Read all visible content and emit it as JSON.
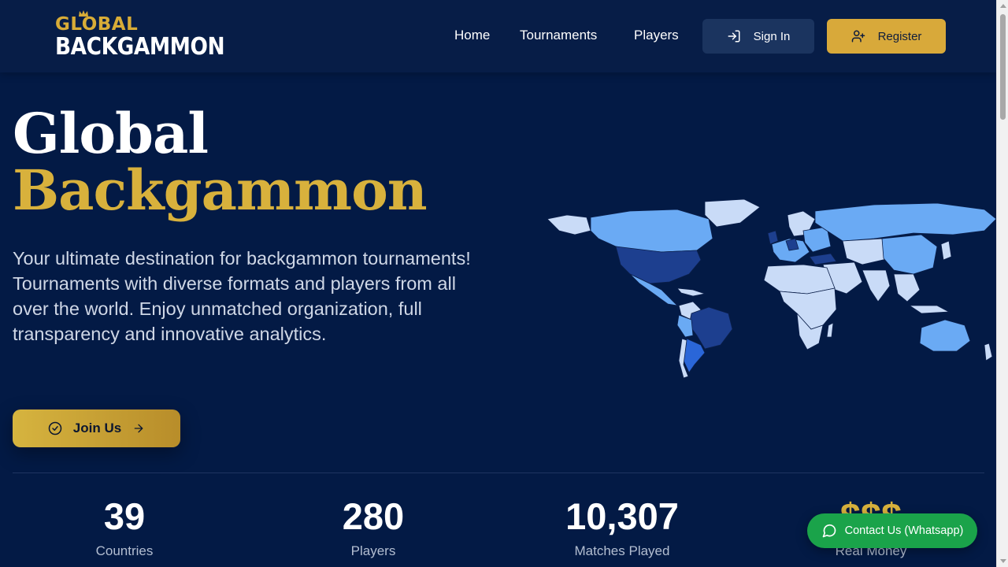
{
  "header": {
    "logo_top": "GLOBAL",
    "logo_bottom": "BACKGAMMON",
    "nav": [
      {
        "label": "Home"
      },
      {
        "label": "Tournaments"
      },
      {
        "label": "Players"
      }
    ],
    "signin_label": "Sign In",
    "register_label": "Register"
  },
  "hero": {
    "title_line1": "Global",
    "title_line2": "Backgammon",
    "description": "Your ultimate destination for backgammon tournaments! Tournaments with diverse formats and players from all over the world. Enjoy unmatched organization, full transparency and innovative analytics.",
    "join_label": "Join Us"
  },
  "stats": [
    {
      "value": "39",
      "label": "Countries"
    },
    {
      "value": "280",
      "label": "Players"
    },
    {
      "value": "10,307",
      "label": "Matches Played"
    },
    {
      "value": "$$$",
      "label": "Real Money"
    }
  ],
  "whatsapp_label": "Contact Us (Whatsapp)",
  "colors": {
    "background": "#031a45",
    "gold": "#d8b13c",
    "whatsapp": "#1aa34a",
    "map_light": "#c9dbf7",
    "map_mid": "#6aaaf4",
    "map_dark": "#1d3f8f"
  }
}
